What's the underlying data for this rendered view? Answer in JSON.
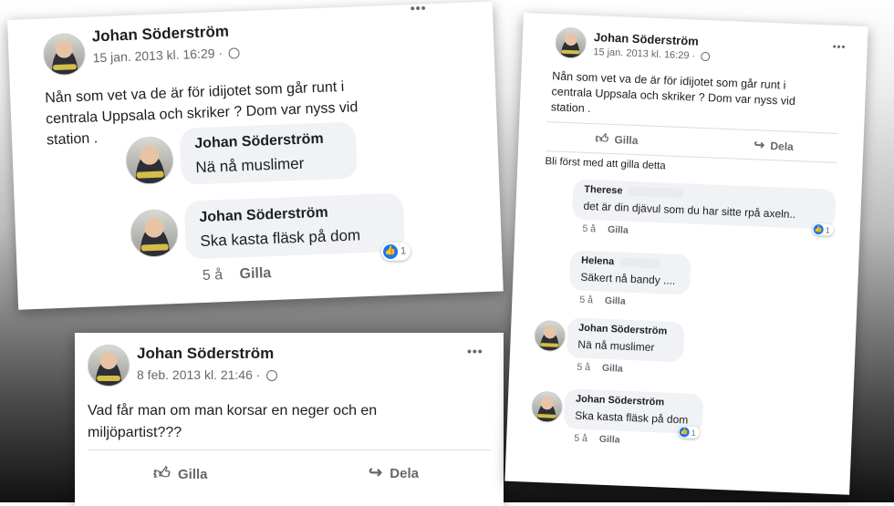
{
  "card1": {
    "author": "Johan Söderström",
    "timestamp": "15 jan. 2013 kl. 16:29 ·",
    "menu": "•••",
    "post_text_1": "Nån som vet va de är för idijotet som går runt i",
    "post_text_2": "centrala Uppsala och skriker ? Dom var nyss vid",
    "post_text_3": "station .",
    "comments": [
      {
        "name": "Johan Söderström",
        "text": "Nä nå muslimer"
      },
      {
        "name": "Johan Söderström",
        "text": "Ska kasta fläsk på dom",
        "age": "5 å",
        "like": "Gilla",
        "reactions": "1"
      }
    ]
  },
  "card2": {
    "author": "Johan Söderström",
    "timestamp": "8 feb. 2013 kl. 21:46 ·",
    "menu": "•••",
    "post_text_1": "Vad får man om man korsar en neger och en",
    "post_text_2": "miljöpartist???",
    "like_label": "Gilla",
    "share_label": "Dela"
  },
  "card3": {
    "author": "Johan Söderström",
    "timestamp": "15 jan. 2013 kl. 16:29 ·",
    "menu": "•••",
    "post_text_1": "Nån som vet va de är för idijotet som går runt i",
    "post_text_2": "centrala Uppsala och skriker ? Dom var nyss vid",
    "post_text_3": "station .",
    "like_label": "Gilla",
    "share_label": "Dela",
    "first_like": "Bli först med att gilla detta",
    "comments": [
      {
        "name": "Therese",
        "text": "det är din djävul som du har sitte rpå axeln..",
        "age": "5 å",
        "like": "Gilla",
        "reactions": "1"
      },
      {
        "name": "Helena",
        "text": "Säkert nå bandy ....",
        "age": "5 å",
        "like": "Gilla"
      },
      {
        "name": "Johan Söderström",
        "text": "Nä nå muslimer",
        "age": "5 å",
        "like": "Gilla"
      },
      {
        "name": "Johan Söderström",
        "text": "Ska kasta fläsk på dom",
        "age": "5 å",
        "like": "Gilla",
        "reactions": "1"
      }
    ]
  },
  "colors": {
    "reaction_blue": "#1877f2",
    "bubble_bg": "#f0f2f5",
    "meta_gray": "#65676b"
  },
  "icons": [
    "globe-icon",
    "thumbs-up-icon",
    "share-arrow-icon",
    "more-dots-icon"
  ]
}
